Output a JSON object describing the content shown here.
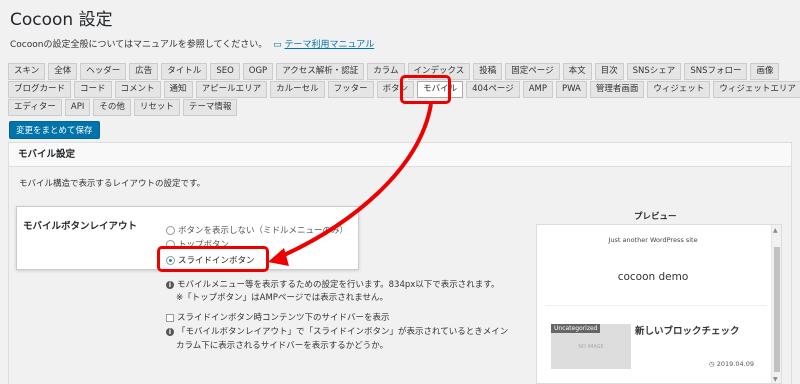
{
  "page": {
    "title": "Cocoon 設定",
    "description": "Cocoonの設定全般についてはマニュアルを参照してください。",
    "manual_link": "テーマ利用マニュアル",
    "book_icon": "book-icon"
  },
  "tabs": {
    "row1": [
      "スキン",
      "全体",
      "ヘッダー",
      "広告",
      "タイトル",
      "SEO",
      "OGP",
      "アクセス解析・認証",
      "カラム",
      "インデックス",
      "投稿",
      "固定ページ",
      "本文",
      "目次",
      "SNSシェア",
      "SNSフォロー",
      "画像"
    ],
    "row2": [
      "ブログカード",
      "コード",
      "コメント",
      "通知",
      "アピールエリア",
      "カルーセル",
      "フッター",
      "ボタン",
      "モバイル",
      "404ページ",
      "AMP",
      "PWA",
      "管理者画面",
      "ウィジェット",
      "ウィジェットエリア"
    ],
    "row3": [
      "エディター",
      "API",
      "その他",
      "リセット",
      "テーマ情報"
    ],
    "active": "モバイル"
  },
  "save_button": "変更をまとめて保存",
  "panel": {
    "heading": "モバイル設定",
    "description": "モバイル構造で表示するレイアウトの設定です。",
    "setting_label": "モバイルボタンレイアウト",
    "options": [
      {
        "label": "ボタンを表示しない（ミドルメニューのみ）",
        "checked": false
      },
      {
        "label": "トップボタン",
        "checked": false
      },
      {
        "label": "スライドインボタン",
        "checked": true
      }
    ],
    "info1": "モバイルメニュー等を表示するための設定を行います。834px以下で表示されます。",
    "info2": "※「トップボタン」はAMPページでは表示されません。",
    "checkbox_label": "スライドインボタン時コンテンツ下のサイドバーを表示",
    "info3_line1": "「モバイルボタンレイアウト」で「スライドインボタン」が表示されているときメイン",
    "info3_line2": "カラム下に表示されるサイドバーを表示するかどうか。",
    "info_icon": "i"
  },
  "preview": {
    "label": "プレビュー",
    "tagline": "Just another WordPress site",
    "site_name": "cocoon demo",
    "category": "Uncategorized",
    "no_image": "NO IMAGE",
    "post_title": "新しいブロックチェック",
    "date": "2019.04.09",
    "clock_icon": "clock-icon"
  },
  "colors": {
    "accent": "#0073aa",
    "annotation_red": "#e00000"
  }
}
